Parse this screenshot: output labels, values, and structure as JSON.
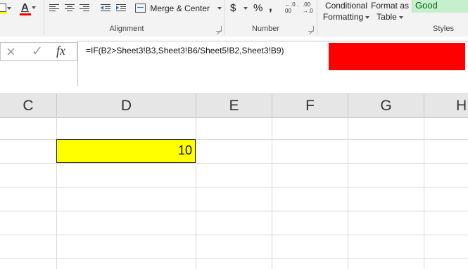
{
  "ribbon": {
    "font_color_letter": "A",
    "merge_center_label": "Merge & Center",
    "alignment_group_label": "Alignment",
    "currency_symbol": "$",
    "percent_symbol": "%",
    "comma_symbol": ",",
    "decrease_decimal_label": "←.0 .00",
    "increase_decimal_label": ".00 →.0",
    "number_group_label": "Number",
    "conditional_formatting_line1": "Conditional",
    "conditional_formatting_line2": "Formatting",
    "format_as_table_line1": "Format as",
    "format_as_table_line2": "Table",
    "good_style_label": "Good",
    "styles_group_label": "Styles",
    "colors": {
      "font_color_bar": "#ff0000",
      "good_style_bg": "#c6efce",
      "good_style_text": "#006100"
    }
  },
  "formula_bar": {
    "cancel_icon": "×",
    "enter_icon": "✓",
    "fx_label": "fx",
    "formula": "=IF(B2>Sheet3!B3,Sheet3!B6/Sheet5!B2,Sheet3!B9)",
    "overlay_color": "#ff0000"
  },
  "grid": {
    "columns": [
      "C",
      "D",
      "E",
      "F",
      "G",
      "H"
    ],
    "highlighted_cell": {
      "column": "D",
      "value": "10",
      "fill": "#ffff00"
    }
  }
}
